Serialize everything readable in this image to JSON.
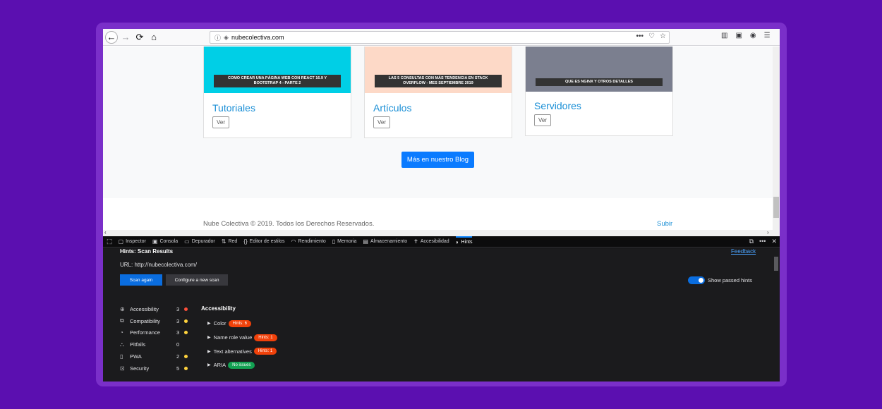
{
  "browser": {
    "url": "nubecolectiva.com",
    "toolbar_icons": [
      "back-icon",
      "forward-icon",
      "reload-icon",
      "home-icon",
      "info-icon",
      "shield-icon",
      "more-icon",
      "pocket-icon",
      "star-icon",
      "library-icon",
      "sidebar-icon",
      "account-icon",
      "menu-icon"
    ]
  },
  "page": {
    "cards": [
      {
        "banner": "COMO CREAR UNA PÁGINA WEB CON REACT 16.9 Y BOOTSTRAP 4 - PARTE 2",
        "title": "Tutoriales",
        "button": "Ver",
        "color": "#00cfe6"
      },
      {
        "banner": "LAS 5 CONSULTAS CON MÁS TENDENCIA EN STACK OVERFLOW - MES SEPTIEMBRE 2019",
        "title": "Artículos",
        "button": "Ver",
        "color": "#fdd9c7"
      },
      {
        "banner": "QUE ES NGINX Y OTROS DETALLES",
        "title": "Servidores",
        "button": "Ver",
        "color": "#7b7f8f"
      }
    ],
    "blog_button": "Más en nuestro Blog",
    "footer_text": "Nube Colectiva © 2019. Todos los Derechos Reservados.",
    "subir": "Subir"
  },
  "devtools": {
    "tabs": [
      {
        "label": "Inspector",
        "icon": "inspector-icon"
      },
      {
        "label": "Consola",
        "icon": "console-icon"
      },
      {
        "label": "Depurador",
        "icon": "debugger-icon"
      },
      {
        "label": "Red",
        "icon": "network-icon"
      },
      {
        "label": "Editor de estilos",
        "icon": "style-editor-icon"
      },
      {
        "label": "Rendimiento",
        "icon": "performance-icon"
      },
      {
        "label": "Memoria",
        "icon": "memory-icon"
      },
      {
        "label": "Almacenamiento",
        "icon": "storage-icon"
      },
      {
        "label": "Accesibilidad",
        "icon": "accessibility-icon"
      },
      {
        "label": "Hints",
        "icon": "hints-icon",
        "active": true
      }
    ],
    "hints": {
      "title": "Hints: Scan Results",
      "feedback": "Feedback",
      "url_line": "URL: http://nubecolectiva.com/",
      "scan_again": "Scan again",
      "configure": "Configure a new scan",
      "show_passed": "Show passed hints",
      "show_passed_on": true,
      "categories": [
        {
          "label": "Accessibility",
          "count": "3",
          "status_color": "#ff4f3a",
          "icon": "accessibility-icon"
        },
        {
          "label": "Compatibility",
          "count": "3",
          "status_color": "#ffd33d",
          "icon": "compatibility-icon"
        },
        {
          "label": "Performance",
          "count": "3",
          "status_color": "#ffd33d",
          "icon": "performance-icon"
        },
        {
          "label": "Pitfalls",
          "count": "0",
          "status_color": "",
          "icon": "pitfalls-icon"
        },
        {
          "label": "PWA",
          "count": "2",
          "status_color": "#ffd33d",
          "icon": "pwa-icon"
        },
        {
          "label": "Security",
          "count": "5",
          "status_color": "#ffd33d",
          "icon": "security-icon"
        }
      ],
      "section_title": "Accessibility",
      "items": [
        {
          "label": "Color",
          "badge": "Hints: 6",
          "badge_color": "#f0410a"
        },
        {
          "label": "Name role value",
          "badge": "Hints: 1",
          "badge_color": "#f0410a"
        },
        {
          "label": "Text alternatives",
          "badge": "Hints: 1",
          "badge_color": "#f0410a"
        },
        {
          "label": "ARIA",
          "badge": "No issues",
          "badge_color": "#12a152"
        }
      ]
    }
  }
}
